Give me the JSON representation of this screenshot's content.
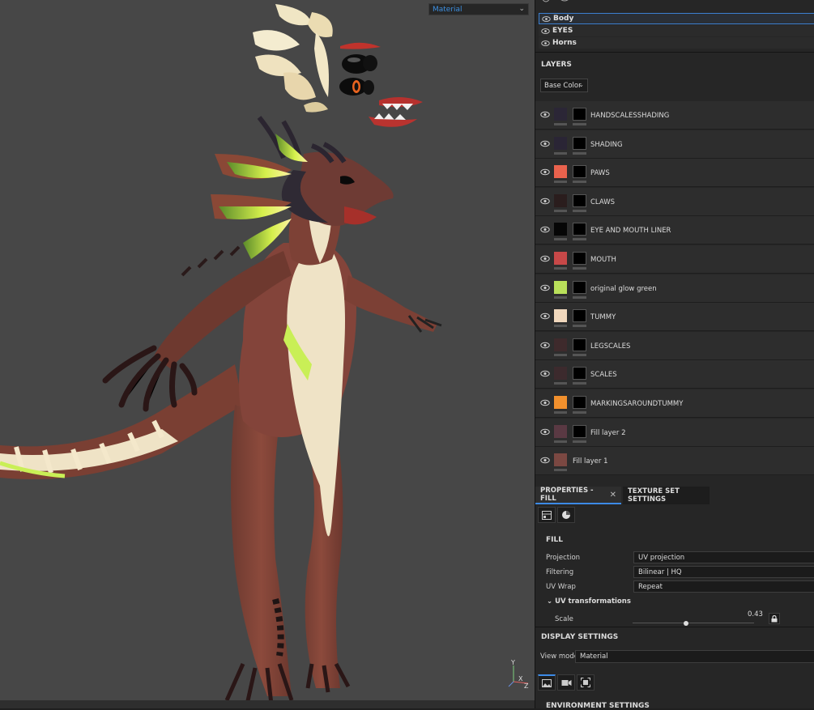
{
  "viewport": {
    "mode_select": "Material",
    "axis_labels": {
      "y": "Y",
      "x": "X",
      "z": "Z"
    }
  },
  "texture_sets": [
    {
      "label": "Body",
      "selected": true
    },
    {
      "label": "EYES",
      "selected": false
    },
    {
      "label": "Horns",
      "selected": false
    }
  ],
  "layers_panel": {
    "title": "LAYERS",
    "channel": "Base Color",
    "layers": [
      {
        "name": "HANDSCALESSHADING",
        "color": "#2b2636",
        "has_mask": true
      },
      {
        "name": "SHADING",
        "color": "#2a2535",
        "has_mask": true
      },
      {
        "name": "PAWS",
        "color": "#e9624d",
        "has_mask": true
      },
      {
        "name": "CLAWS",
        "color": "#2a1d1d",
        "has_mask": true
      },
      {
        "name": "EYE AND MOUTH LINER",
        "color": "#060606",
        "has_mask": true
      },
      {
        "name": "MOUTH",
        "color": "#c74848",
        "has_mask": true
      },
      {
        "name": "original glow green",
        "color": "#b9e05a",
        "has_mask": true
      },
      {
        "name": "TUMMY",
        "color": "#f1d8bd",
        "has_mask": true
      },
      {
        "name": "LEGSCALES",
        "color": "#3e2a2c",
        "has_mask": true
      },
      {
        "name": "SCALES",
        "color": "#3c2a2d",
        "has_mask": true
      },
      {
        "name": "MARKINGSAROUNDTUMMY",
        "color": "#f1902d",
        "has_mask": true
      },
      {
        "name": "Fill layer 2",
        "color": "#5a3943",
        "has_mask": true
      },
      {
        "name": "Fill layer 1",
        "color": "#7b4842",
        "has_mask": false
      }
    ]
  },
  "properties": {
    "tab_active": "PROPERTIES - FILL",
    "tab_other": "TEXTURE SET SETTINGS",
    "section": "FILL",
    "rows": [
      {
        "label": "Projection",
        "value": "UV projection"
      },
      {
        "label": "Filtering",
        "value": "Bilinear | HQ"
      },
      {
        "label": "UV Wrap",
        "value": "Repeat"
      }
    ],
    "uv_transform_label": "UV transformations",
    "scale_label": "Scale",
    "scale_value": "0.43"
  },
  "display_settings": {
    "title": "DISPLAY SETTINGS",
    "view_mode_label": "View mode",
    "view_mode_value": "Material",
    "environment_title": "ENVIRONMENT SETTINGS"
  }
}
